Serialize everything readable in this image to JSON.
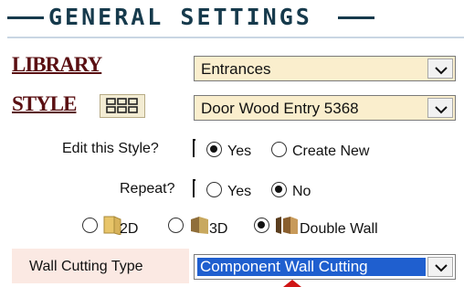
{
  "header": {
    "title": "GENERAL SETTINGS"
  },
  "library": {
    "label": "LIBRARY",
    "value": "Entrances"
  },
  "style": {
    "label": "STYLE",
    "value": "Door Wood Entry 5368",
    "grid_icon": "grid-icon"
  },
  "edit_style": {
    "label": "Edit this Style?",
    "options": [
      "Yes",
      "Create New"
    ],
    "selected": "Yes"
  },
  "repeat": {
    "label": "Repeat?",
    "options": [
      "Yes",
      "No"
    ],
    "selected": "No"
  },
  "view_mode": {
    "options": [
      "2D",
      "3D",
      "Double Wall"
    ],
    "selected": "Double Wall"
  },
  "wall_cutting": {
    "label": "Wall Cutting Type",
    "value": "Component Wall Cutting"
  },
  "colors": {
    "header": "#163a4c",
    "label": "#5a0f12",
    "select_bg": "#faeecd",
    "highlight": "#1f5fcf",
    "wall_cut_bg": "#fbe9e3"
  }
}
